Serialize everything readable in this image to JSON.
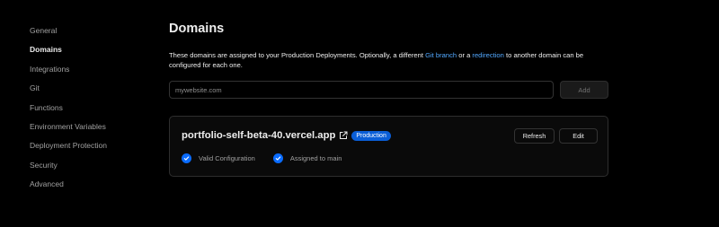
{
  "sidebar": {
    "items": [
      {
        "label": "General"
      },
      {
        "label": "Domains"
      },
      {
        "label": "Integrations"
      },
      {
        "label": "Git"
      },
      {
        "label": "Functions"
      },
      {
        "label": "Environment Variables"
      },
      {
        "label": "Deployment Protection"
      },
      {
        "label": "Security"
      },
      {
        "label": "Advanced"
      }
    ],
    "active": "Domains"
  },
  "main": {
    "title": "Domains",
    "description": {
      "part1": "These domains are assigned to your Production Deployments. Optionally, a different ",
      "link1": "Git branch",
      "part2": " or a ",
      "link2": "redirection",
      "part3": " to another domain can be configured for each one."
    },
    "input": {
      "placeholder": "mywebsite.com",
      "value": ""
    },
    "add_label": "Add"
  },
  "domain_card": {
    "domain": "portfolio-self-beta-40.vercel.app",
    "badge": "Production",
    "refresh_label": "Refresh",
    "edit_label": "Edit",
    "statuses": [
      {
        "label": "Valid Configuration",
        "icon": "check-circle-icon"
      },
      {
        "label": "Assigned to main",
        "icon": "check-circle-icon"
      }
    ]
  },
  "colors": {
    "background": "#000000",
    "link": "#52a8ff",
    "badge": "#0a5ed7",
    "check": "#0a6cff",
    "border": "#2e2e2e"
  }
}
